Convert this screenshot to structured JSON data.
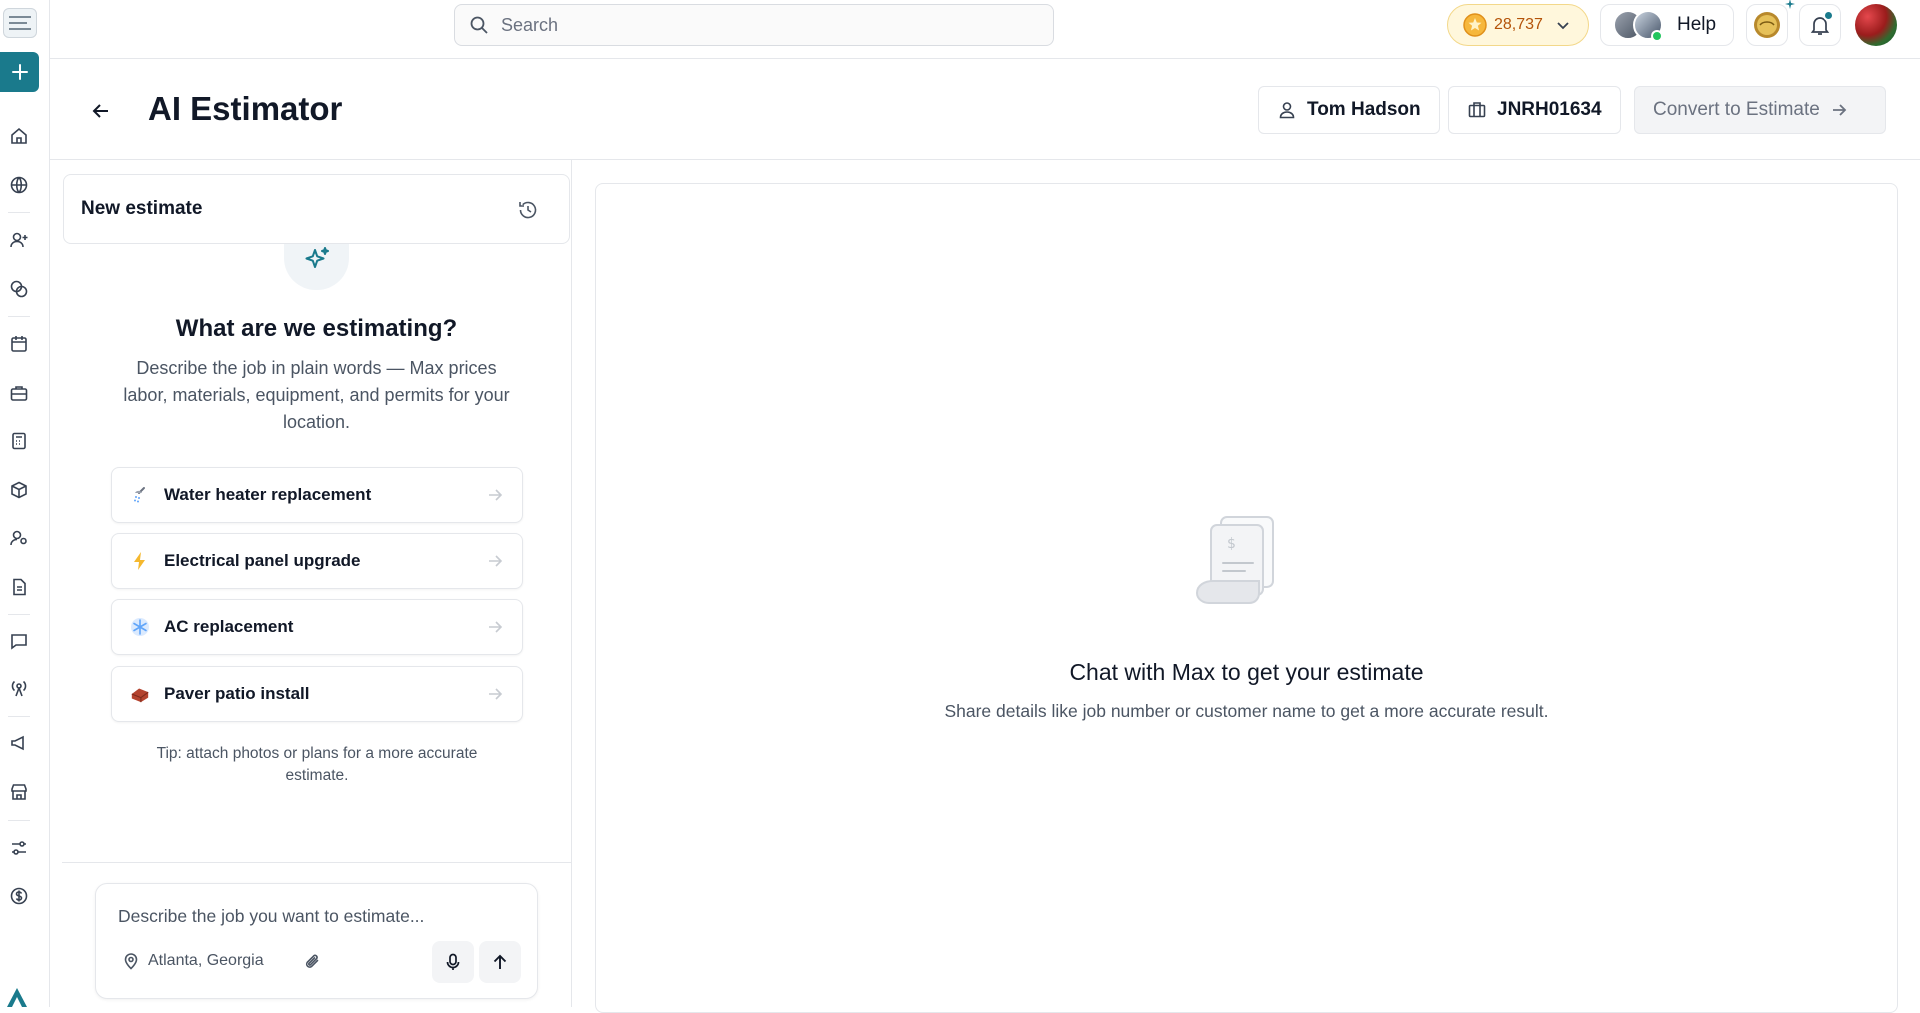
{
  "search": {
    "placeholder": "Search"
  },
  "topbar": {
    "coins": "28,737",
    "help_label": "Help"
  },
  "header": {
    "title": "AI Estimator",
    "customer": "Tom Hadson",
    "job_number": "JNRH01634",
    "convert_label": "Convert to Estimate"
  },
  "left_panel": {
    "new_estimate_label": "New estimate",
    "heading": "What are we estimating?",
    "description": "Describe the job in plain words — Max prices labor, materials, equipment, and permits for your location.",
    "suggestions": [
      {
        "label": "Water heater replacement",
        "icon": "shower-icon"
      },
      {
        "label": "Electrical panel upgrade",
        "icon": "lightning-icon"
      },
      {
        "label": "AC replacement",
        "icon": "snowflake-icon"
      },
      {
        "label": "Paver patio install",
        "icon": "brick-icon"
      }
    ],
    "tip": "Tip: attach photos or plans for a more accurate estimate.",
    "composer": {
      "placeholder": "Describe the job you want to estimate...",
      "location": "Atlanta, Georgia"
    }
  },
  "main": {
    "empty_title": "Chat with Max to get your estimate",
    "empty_subtitle": "Share details like job number or customer name to get a more accurate result."
  },
  "colors": {
    "brand_teal": "#1a7a8c",
    "coin_bg": "#fff7dc",
    "border": "#e5e7eb"
  }
}
